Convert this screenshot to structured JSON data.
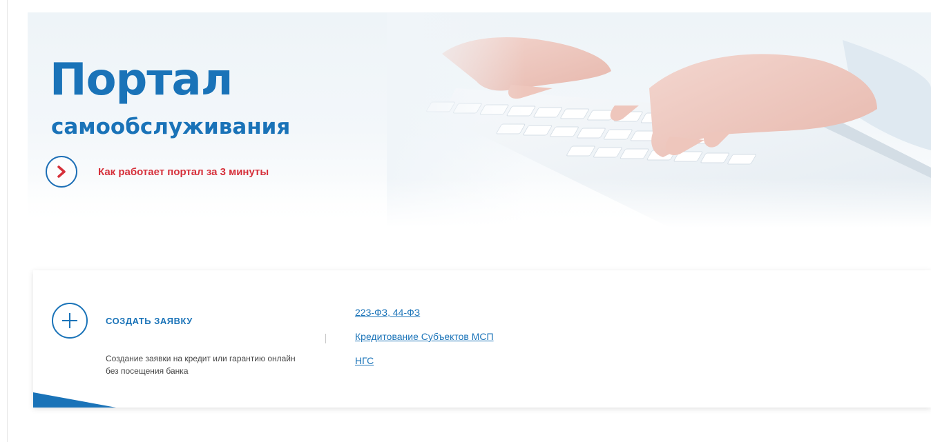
{
  "hero": {
    "title": "Портал",
    "subtitle": "самообслуживания",
    "video_link_label": "Как работает портал за 3 минуты"
  },
  "card": {
    "create_label": "СОЗДАТЬ ЗАЯВКУ",
    "create_description": "Создание заявки на кредит или гарантию онлайн без посещения банка",
    "links": [
      "223-ФЗ, 44-ФЗ",
      "Кредитование Субъектов МСП",
      "НГС"
    ]
  },
  "colors": {
    "brand_blue": "#1a73b8",
    "link_red": "#d6303a"
  },
  "icons": [
    "chevron-right-icon",
    "plus-icon"
  ]
}
